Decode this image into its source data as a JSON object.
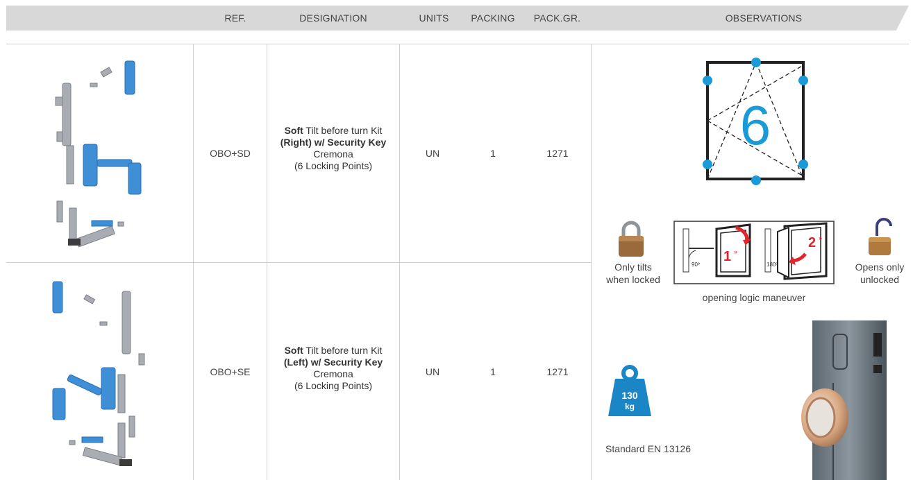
{
  "header": {
    "ref": "REF.",
    "designation": "DESIGNATION",
    "units": "UNITS",
    "packing": "PACKING",
    "pack_gr": "PACK.GR.",
    "observations": "OBSERVATIONS"
  },
  "rows": [
    {
      "ref": "OBO+SD",
      "desc_bold1": "Soft",
      "desc_text1": " Tilt before turn Kit",
      "desc_bold2": "(Right) w/ Security Key",
      "desc_text2": " Cremona",
      "desc_text3": "(6 Locking Points)",
      "units": "UN",
      "packing": "1",
      "pack_gr": "1271"
    },
    {
      "ref": "OBO+SE",
      "desc_bold1": "Soft",
      "desc_text1": " Tilt before turn Kit",
      "desc_bold2": "(Left) w/ Security Key",
      "desc_text2": " Cremona",
      "desc_text3": "(6 Locking Points)",
      "units": "UN",
      "packing": "1",
      "pack_gr": "1271"
    }
  ],
  "observations": {
    "locking_points_number": "6",
    "tilt_caption_1": "Only tilts",
    "tilt_caption_2": "when locked",
    "open_caption_1": "Opens only",
    "open_caption_2": "unlocked",
    "maneuver_caption": "opening logic maneuver",
    "step1": "1",
    "step2": "2",
    "angle1": "90º",
    "angle2": "180º",
    "weight_value": "130",
    "weight_unit": "kg",
    "standard": "Standard EN 13126"
  },
  "colors": {
    "accent_blue": "#1a9ad6",
    "header_gray": "#d8d8d8",
    "arrow_red": "#e0262b",
    "weight_blue": "#1b86c6",
    "part_blue": "#3e8fd6"
  }
}
